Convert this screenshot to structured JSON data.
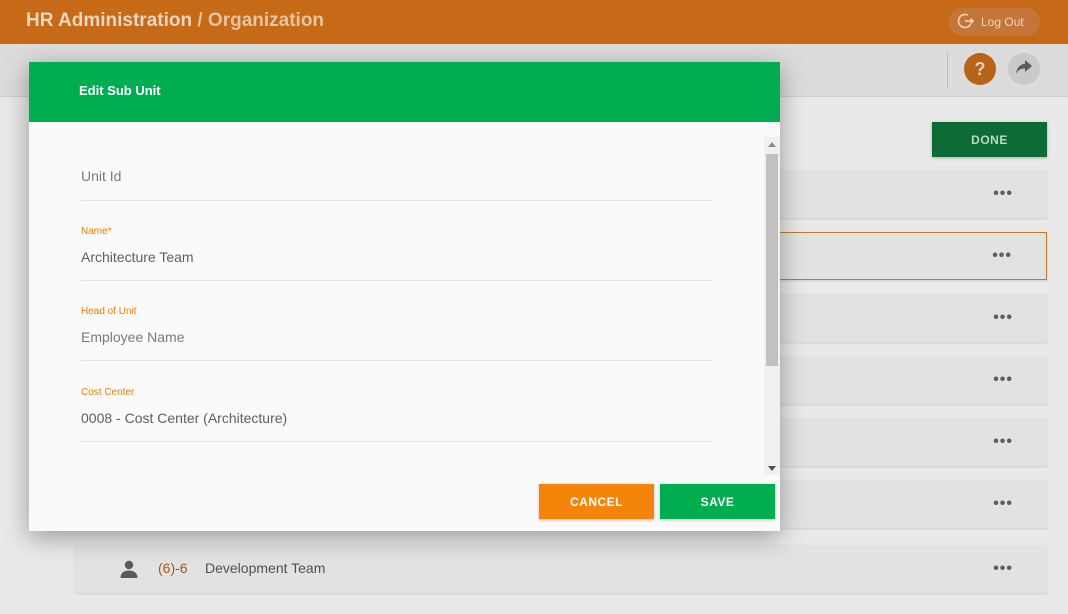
{
  "app": {
    "title": "HR Administration",
    "separator": "/",
    "section": "Organization",
    "logout_label": "Log Out"
  },
  "toolbar": {
    "help_label": "?",
    "done_label": "DONE"
  },
  "tree_rows": [
    {
      "code": "",
      "name": ""
    },
    {
      "code": "",
      "name": ""
    },
    {
      "code": "",
      "name": ""
    },
    {
      "code": "",
      "name": ""
    },
    {
      "code": "",
      "name": ""
    },
    {
      "code": "",
      "name": ""
    },
    {
      "code": "(6)-6",
      "name": "Development Team"
    }
  ],
  "row_menu_label": "•••",
  "dialog": {
    "title": "Edit Sub Unit",
    "fields": {
      "unit_id": {
        "label": "",
        "placeholder": "Unit Id",
        "value": ""
      },
      "name": {
        "label": "Name",
        "required_mark": "*",
        "value": "Architecture Team"
      },
      "head_of_unit": {
        "label": "Head of Unit",
        "placeholder": "Employee Name",
        "value": ""
      },
      "cost_center": {
        "label": "Cost Center",
        "value": "0008 - Cost Center (Architecture)"
      }
    },
    "cancel_label": "CANCEL",
    "save_label": "SAVE"
  },
  "colors": {
    "header_orange": "#c76a18",
    "dialog_green": "#00ad50",
    "accent_orange": "#f5850a",
    "label_orange": "#f07d00"
  },
  "icons": {
    "logout": "logout-icon",
    "help": "help-icon",
    "share": "share-icon",
    "person": "person-icon",
    "more": "more-dots-icon"
  }
}
